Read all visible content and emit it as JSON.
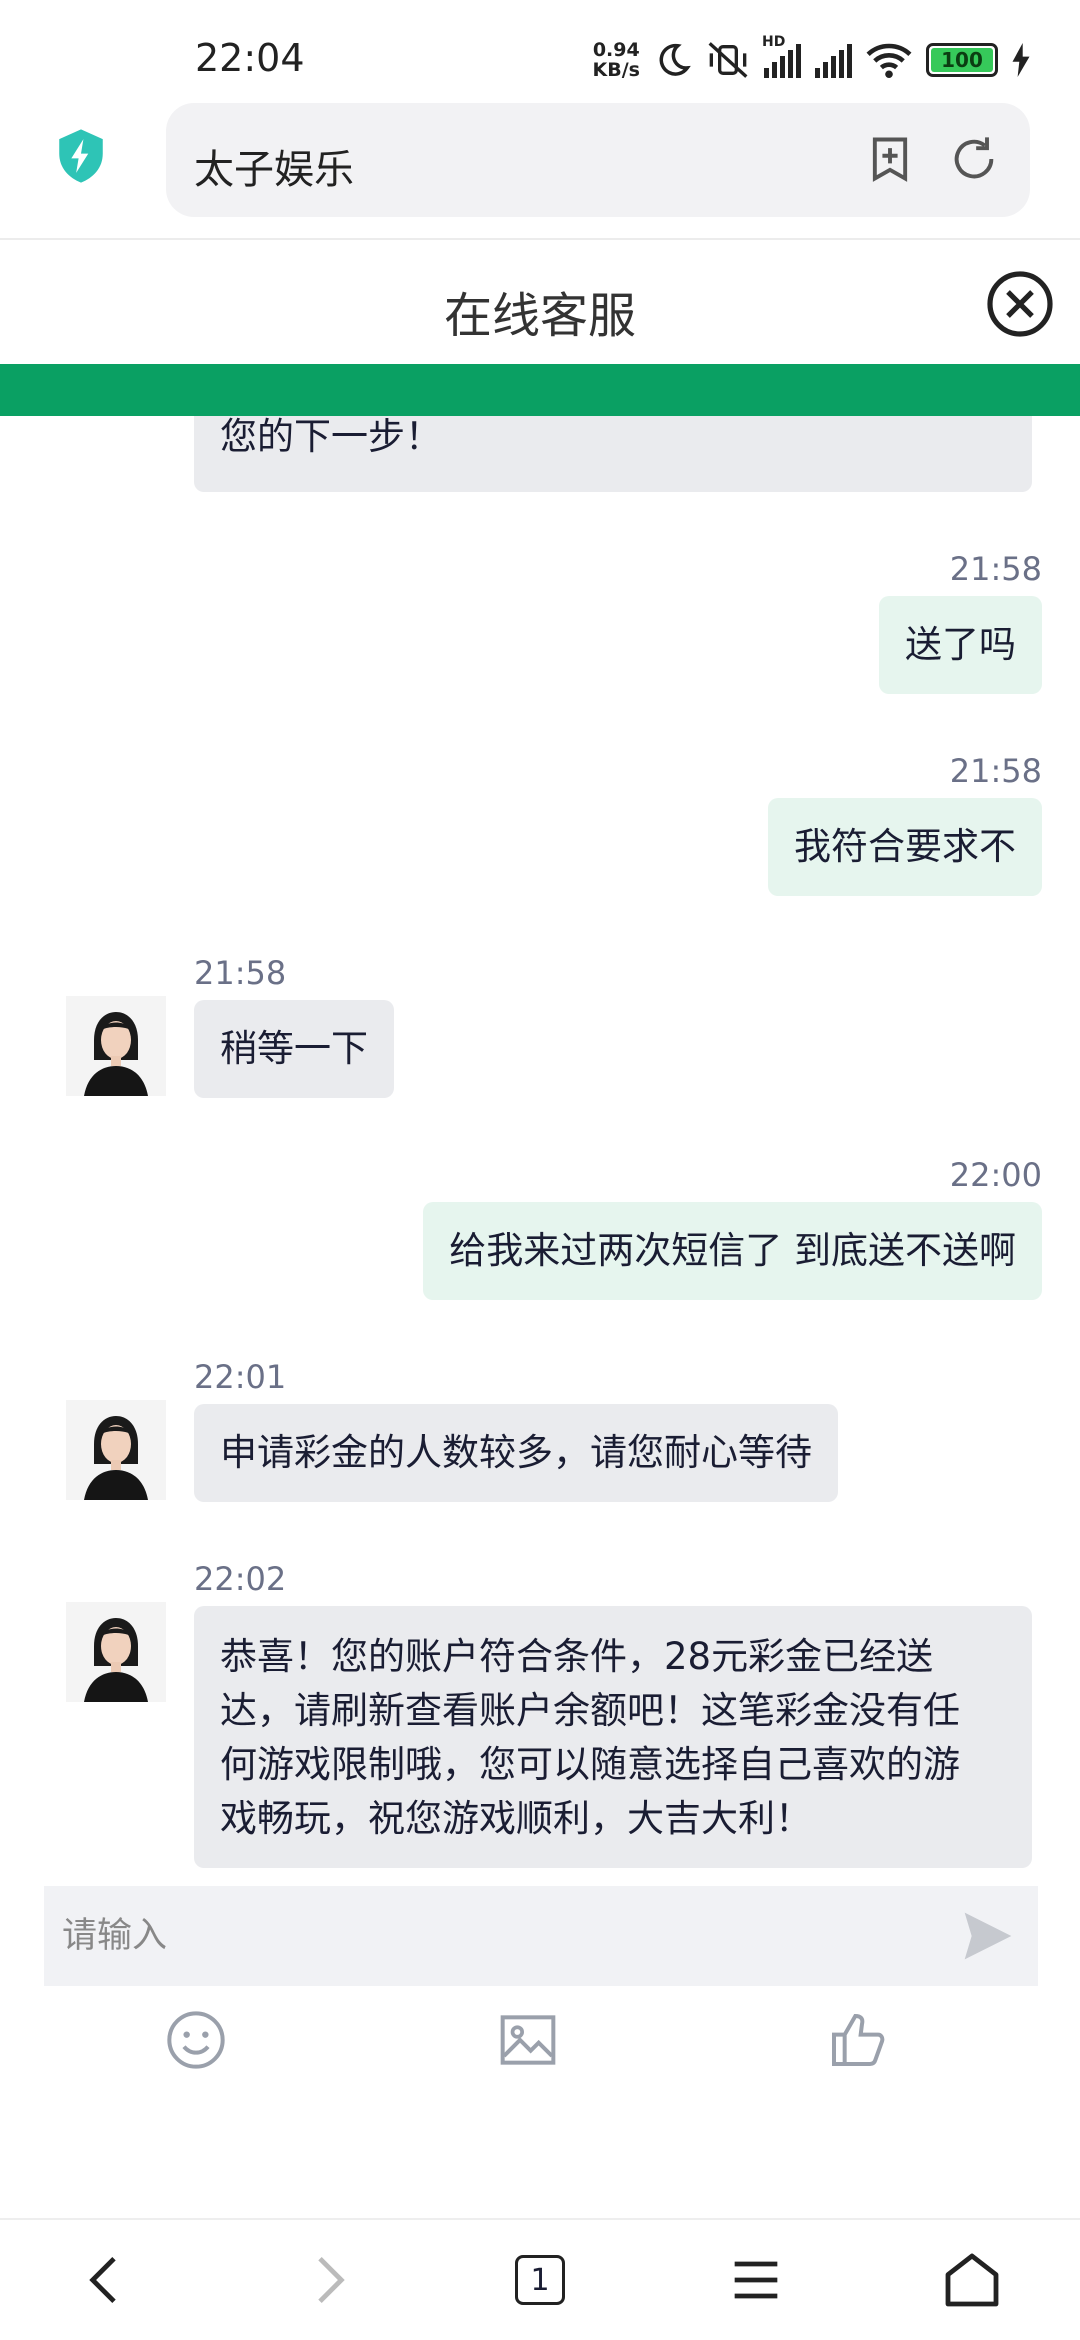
{
  "status_bar": {
    "time": "22:04",
    "net_speed_value": "0.94",
    "net_speed_unit": "KB/s",
    "hd_label": "HD",
    "battery": "100"
  },
  "browser": {
    "address_text": "太子娱乐"
  },
  "header": {
    "title": "在线客服"
  },
  "chat": {
    "partial_message": "您的下一步！",
    "messages": [
      {
        "from": "user",
        "time": "21:58",
        "text": "送了吗"
      },
      {
        "from": "user",
        "time": "21:58",
        "text": "我符合要求不"
      },
      {
        "from": "agent",
        "time": "21:58",
        "text": "稍等一下"
      },
      {
        "from": "user",
        "time": "22:00",
        "text": "给我来过两次短信了 到底送不送啊"
      },
      {
        "from": "agent",
        "time": "22:01",
        "text": "申请彩金的人数较多，请您耐心等待"
      },
      {
        "from": "agent",
        "time": "22:02",
        "lines": [
          "恭喜！您的账户符合条件，28元彩金已经送",
          "达，请刷新查看账户余额吧！这笔彩金没有任",
          "何游戏限制哦，您可以随意选择自己喜欢的游",
          "戏畅玩，祝您游戏顺利，大吉大利！"
        ]
      }
    ]
  },
  "composer": {
    "placeholder": "请输入"
  },
  "toolbar_icons": [
    "emoji-icon",
    "image-icon",
    "thumbs-up-icon"
  ],
  "nav": {
    "tab_count": "1"
  },
  "colors": {
    "accent_green": "#0aa063",
    "user_bubble": "#e6f5ee",
    "agent_bubble": "#eaebee"
  }
}
